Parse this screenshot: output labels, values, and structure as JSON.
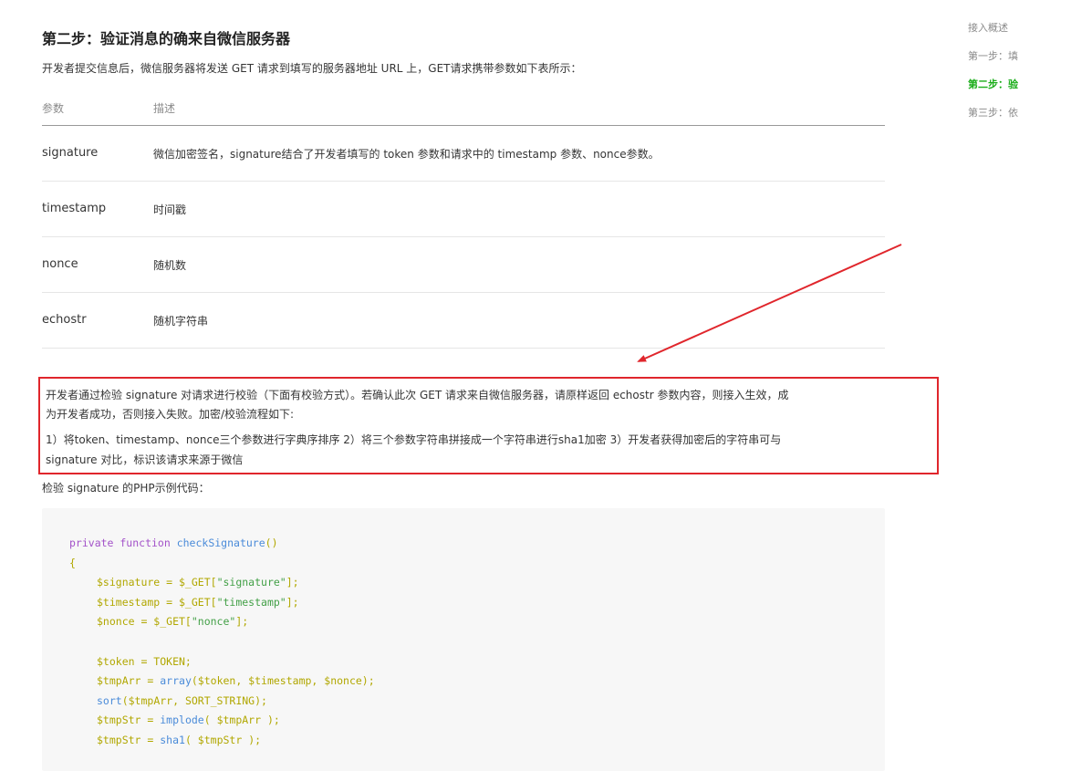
{
  "section": {
    "title": "第二步：验证消息的确来自微信服务器",
    "intro": "开发者提交信息后，微信服务器将发送 GET 请求到填写的服务器地址 URL 上，GET请求携带参数如下表所示："
  },
  "table": {
    "headers": [
      "参数",
      "描述"
    ],
    "rows": [
      {
        "param": "signature",
        "desc": "微信加密签名，signature结合了开发者填写的 token 参数和请求中的 timestamp 参数、nonce参数。"
      },
      {
        "param": "timestamp",
        "desc": "时间戳"
      },
      {
        "param": "nonce",
        "desc": "随机数"
      },
      {
        "param": "echostr",
        "desc": "随机字符串"
      }
    ]
  },
  "highlight": {
    "line1": "开发者通过检验 signature 对请求进行校验（下面有校验方式）。若确认此次 GET 请求来自微信服务器，请原样返回 echostr 参数内容，则接入生效，成",
    "line2": "为开发者成功，否则接入失败。加密/校验流程如下:",
    "line3": "1）将token、timestamp、nonce三个参数进行字典序排序 2）将三个参数字符串拼接成一个字符串进行sha1加密 3）开发者获得加密后的字符串可与",
    "line4": "signature 对比，标识该请求来源于微信",
    "color": "#e0262c"
  },
  "sample_label": "检验 signature 的PHP示例代码：",
  "code": {
    "l1_kw": "private function ",
    "l1_fn": "checkSignature",
    "l1_rest": "()",
    "l2": "{",
    "l3_a": "$signature = $_GET[",
    "l3_s": "\"signature\"",
    "l3_b": "];",
    "l4_a": "$timestamp = $_GET[",
    "l4_s": "\"timestamp\"",
    "l4_b": "];",
    "l5_a": "$nonce = $_GET[",
    "l5_s": "\"nonce\"",
    "l5_b": "];",
    "l6": "$token = TOKEN;",
    "l7_a": "$tmpArr = ",
    "l7_fn": "array",
    "l7_b": "($token, $timestamp, $nonce);",
    "l8_fn": "sort",
    "l8_b": "($tmpArr, SORT_STRING);",
    "l9_a": "$tmpStr = ",
    "l9_fn": "implode",
    "l9_b": "( $tmpArr );",
    "l10_a": "$tmpStr = ",
    "l10_fn": "sha1",
    "l10_b": "( $tmpStr );"
  },
  "toc": {
    "items": [
      "接入概述",
      "第一步：填",
      "第二步：验",
      "第三步：依"
    ],
    "active_color": "#1aad19"
  }
}
